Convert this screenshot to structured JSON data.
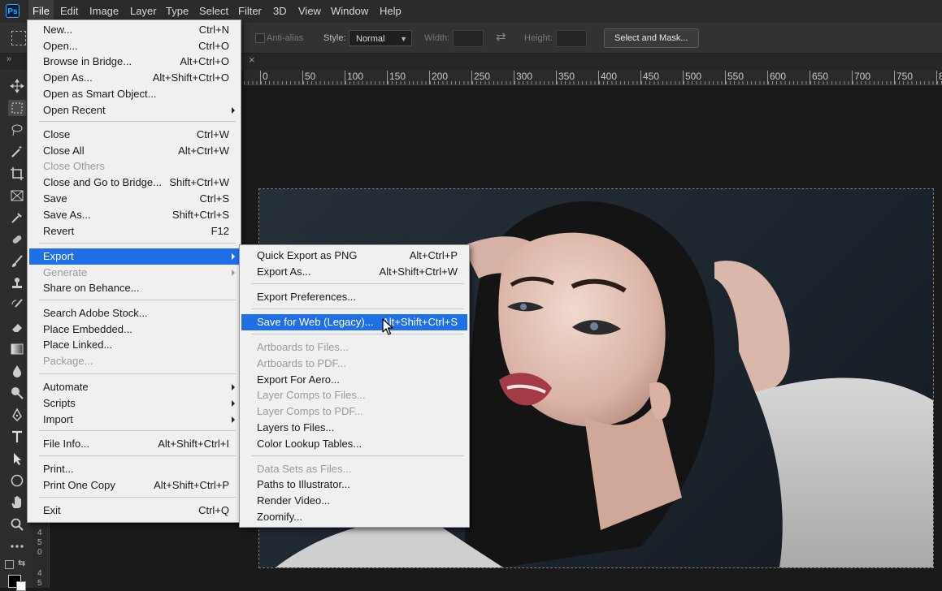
{
  "menubar": {
    "items": [
      "File",
      "Edit",
      "Image",
      "Layer",
      "Type",
      "Select",
      "Filter",
      "3D",
      "View",
      "Window",
      "Help"
    ]
  },
  "options_bar": {
    "anti_alias": "Anti-alias",
    "style_label": "Style:",
    "style_value": "Normal",
    "width_label": "Width:",
    "height_label": "Height:",
    "select_mask_button": "Select and Mask..."
  },
  "ruler": {
    "ticks": [
      "0",
      "50",
      "100",
      "150",
      "200",
      "250",
      "300",
      "350",
      "400",
      "450",
      "500",
      "550",
      "600",
      "650",
      "700",
      "750",
      "8"
    ]
  },
  "vruler": {
    "labels": [
      "4",
      "5",
      "0",
      "4",
      "5"
    ]
  },
  "doc_tab": {
    "close_glyph": "×"
  },
  "file_menu": {
    "items": [
      {
        "label": "New...",
        "shortcut": "Ctrl+N"
      },
      {
        "label": "Open...",
        "shortcut": "Ctrl+O"
      },
      {
        "label": "Browse in Bridge...",
        "shortcut": "Alt+Ctrl+O"
      },
      {
        "label": "Open As...",
        "shortcut": "Alt+Shift+Ctrl+O"
      },
      {
        "label": "Open as Smart Object...",
        "shortcut": ""
      },
      {
        "label": "Open Recent",
        "shortcut": ""
      },
      {
        "label": "Close",
        "shortcut": "Ctrl+W"
      },
      {
        "label": "Close All",
        "shortcut": "Alt+Ctrl+W"
      },
      {
        "label": "Close Others",
        "shortcut": ""
      },
      {
        "label": "Close and Go to Bridge...",
        "shortcut": "Shift+Ctrl+W"
      },
      {
        "label": "Save",
        "shortcut": "Ctrl+S"
      },
      {
        "label": "Save As...",
        "shortcut": "Shift+Ctrl+S"
      },
      {
        "label": "Revert",
        "shortcut": "F12"
      },
      {
        "label": "Export",
        "shortcut": ""
      },
      {
        "label": "Generate",
        "shortcut": ""
      },
      {
        "label": "Share on Behance...",
        "shortcut": ""
      },
      {
        "label": "Search Adobe Stock...",
        "shortcut": ""
      },
      {
        "label": "Place Embedded...",
        "shortcut": ""
      },
      {
        "label": "Place Linked...",
        "shortcut": ""
      },
      {
        "label": "Package...",
        "shortcut": ""
      },
      {
        "label": "Automate",
        "shortcut": ""
      },
      {
        "label": "Scripts",
        "shortcut": ""
      },
      {
        "label": "Import",
        "shortcut": ""
      },
      {
        "label": "File Info...",
        "shortcut": "Alt+Shift+Ctrl+I"
      },
      {
        "label": "Print...",
        "shortcut": ""
      },
      {
        "label": "Print One Copy",
        "shortcut": "Alt+Shift+Ctrl+P"
      },
      {
        "label": "Exit",
        "shortcut": "Ctrl+Q"
      }
    ]
  },
  "export_menu": {
    "items": [
      {
        "label": "Quick Export as PNG",
        "shortcut": "Alt+Ctrl+P"
      },
      {
        "label": "Export As...",
        "shortcut": "Alt+Shift+Ctrl+W"
      },
      {
        "label": "Export Preferences...",
        "shortcut": ""
      },
      {
        "label": "Save for Web (Legacy)...",
        "shortcut": "Alt+Shift+Ctrl+S"
      },
      {
        "label": "Artboards to Files...",
        "shortcut": ""
      },
      {
        "label": "Artboards to PDF...",
        "shortcut": ""
      },
      {
        "label": "Export For Aero...",
        "shortcut": ""
      },
      {
        "label": "Layer Comps to Files...",
        "shortcut": ""
      },
      {
        "label": "Layer Comps to PDF...",
        "shortcut": ""
      },
      {
        "label": "Layers to Files...",
        "shortcut": ""
      },
      {
        "label": "Color Lookup Tables...",
        "shortcut": ""
      },
      {
        "label": "Data Sets as Files...",
        "shortcut": ""
      },
      {
        "label": "Paths to Illustrator...",
        "shortcut": ""
      },
      {
        "label": "Render Video...",
        "shortcut": ""
      },
      {
        "label": "Zoomify...",
        "shortcut": ""
      }
    ]
  },
  "colors": {
    "menu_highlight": "#1f6fe6",
    "accent": "#31a8ff"
  },
  "logo_text": "Ps"
}
